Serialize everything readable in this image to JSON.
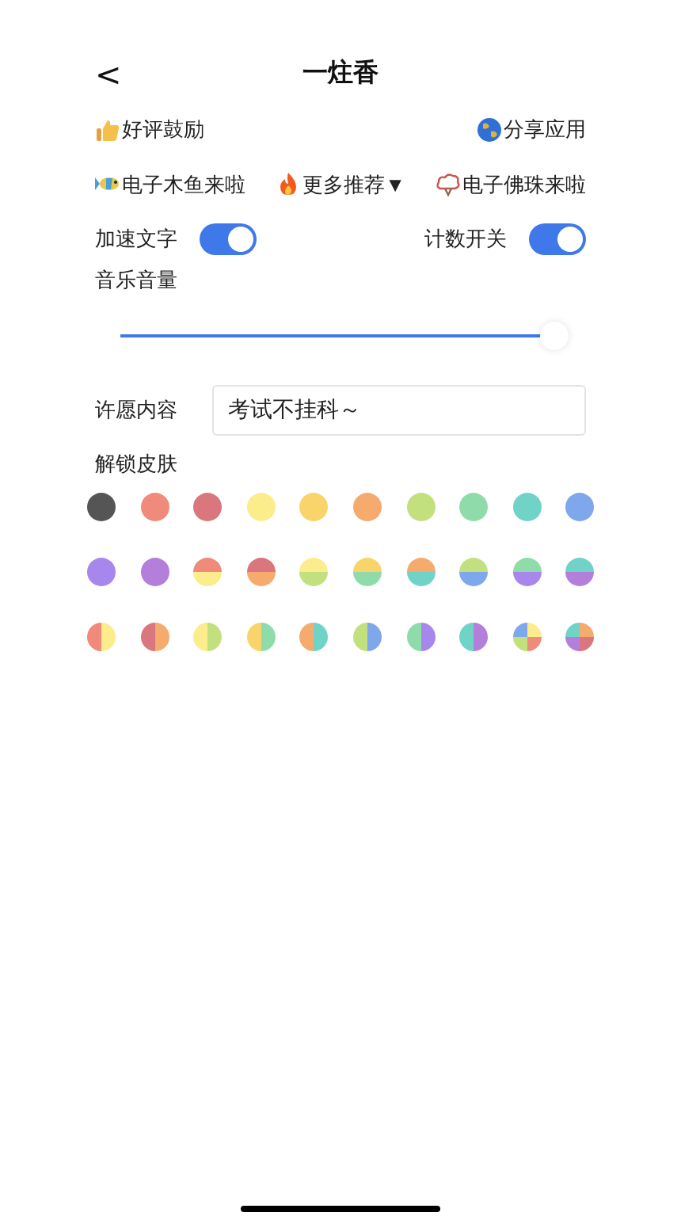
{
  "header": {
    "back": "<",
    "title": "一炷香"
  },
  "links_top": [
    {
      "kind": "thumb",
      "label": "好评鼓励"
    },
    {
      "kind": "globe",
      "label": "分享应用"
    }
  ],
  "links": [
    {
      "kind": "fish",
      "label": "电子木鱼来啦"
    },
    {
      "kind": "fire",
      "label": "更多推荐▼"
    },
    {
      "kind": "beads",
      "label": "电子佛珠来啦"
    }
  ],
  "toggles": [
    {
      "label": "加速文字",
      "on": true
    },
    {
      "label": "计数开关",
      "on": true
    }
  ],
  "volume": {
    "label": "音乐音量",
    "level": 0.98
  },
  "wish": {
    "label": "许愿内容",
    "value": "考试不挂科～"
  },
  "skins_label": "解锁皮肤",
  "skins": [
    {
      "kind": "solid",
      "parts": [
        {
          "color": "#555555"
        }
      ]
    },
    {
      "kind": "solid",
      "parts": [
        {
          "color": "#f08a7a"
        }
      ]
    },
    {
      "kind": "solid",
      "parts": [
        {
          "color": "#d9767e"
        }
      ]
    },
    {
      "kind": "solid",
      "parts": [
        {
          "color": "#fbec8c"
        }
      ]
    },
    {
      "kind": "solid",
      "parts": [
        {
          "color": "#f9d46a"
        }
      ]
    },
    {
      "kind": "solid",
      "parts": [
        {
          "color": "#f5aa6e"
        }
      ]
    },
    {
      "kind": "solid",
      "parts": [
        {
          "color": "#c3e07e"
        }
      ]
    },
    {
      "kind": "solid",
      "parts": [
        {
          "color": "#8fdcaa"
        }
      ]
    },
    {
      "kind": "solid",
      "parts": [
        {
          "color": "#6fd3c8"
        }
      ]
    },
    {
      "kind": "solid",
      "parts": [
        {
          "color": "#7ea7ec"
        }
      ]
    },
    {
      "kind": "solid",
      "parts": [
        {
          "color": "#a787ec"
        }
      ]
    },
    {
      "kind": "solid",
      "parts": [
        {
          "color": "#b47fdb"
        }
      ]
    },
    {
      "kind": "stacked",
      "parts": [
        {
          "color": "#f08a7a"
        },
        {
          "color": "#fbec8c"
        }
      ]
    },
    {
      "kind": "stacked",
      "parts": [
        {
          "color": "#d9767e"
        },
        {
          "color": "#f5aa6e"
        }
      ]
    },
    {
      "kind": "stacked",
      "parts": [
        {
          "color": "#fbec8c"
        },
        {
          "color": "#c3e07e"
        }
      ]
    },
    {
      "kind": "stacked",
      "parts": [
        {
          "color": "#f9d46a"
        },
        {
          "color": "#8fdcaa"
        }
      ]
    },
    {
      "kind": "stacked",
      "parts": [
        {
          "color": "#f5aa6e"
        },
        {
          "color": "#6fd3c8"
        }
      ]
    },
    {
      "kind": "stacked",
      "parts": [
        {
          "color": "#c3e07e"
        },
        {
          "color": "#7ea7ec"
        }
      ]
    },
    {
      "kind": "stacked",
      "parts": [
        {
          "color": "#8fdcaa"
        },
        {
          "color": "#a787ec"
        }
      ]
    },
    {
      "kind": "stacked",
      "parts": [
        {
          "color": "#6fd3c8"
        },
        {
          "color": "#b47fdb"
        }
      ]
    },
    {
      "kind": "split",
      "parts": [
        {
          "color": "#f08a7a"
        },
        {
          "color": "#fbec8c"
        }
      ]
    },
    {
      "kind": "split",
      "parts": [
        {
          "color": "#d9767e"
        },
        {
          "color": "#f5aa6e"
        }
      ]
    },
    {
      "kind": "split",
      "parts": [
        {
          "color": "#fbec8c"
        },
        {
          "color": "#c3e07e"
        }
      ]
    },
    {
      "kind": "split",
      "parts": [
        {
          "color": "#f9d46a"
        },
        {
          "color": "#8fdcaa"
        }
      ]
    },
    {
      "kind": "split",
      "parts": [
        {
          "color": "#f5aa6e"
        },
        {
          "color": "#6fd3c8"
        }
      ]
    },
    {
      "kind": "split",
      "parts": [
        {
          "color": "#c3e07e"
        },
        {
          "color": "#7ea7ec"
        }
      ]
    },
    {
      "kind": "split",
      "parts": [
        {
          "color": "#8fdcaa"
        },
        {
          "color": "#a787ec"
        }
      ]
    },
    {
      "kind": "split",
      "parts": [
        {
          "color": "#6fd3c8"
        },
        {
          "color": "#b47fdb"
        }
      ]
    },
    {
      "kind": "quad",
      "parts": [
        {
          "color": "#7ea7ec"
        },
        {
          "color": "#fbec8c"
        },
        {
          "color": "#c3e07e"
        },
        {
          "color": "#f08a7a"
        }
      ]
    },
    {
      "kind": "quad",
      "parts": [
        {
          "color": "#6fd3c8"
        },
        {
          "color": "#f5aa6e"
        },
        {
          "color": "#b47fdb"
        },
        {
          "color": "#d9767e"
        }
      ]
    }
  ]
}
